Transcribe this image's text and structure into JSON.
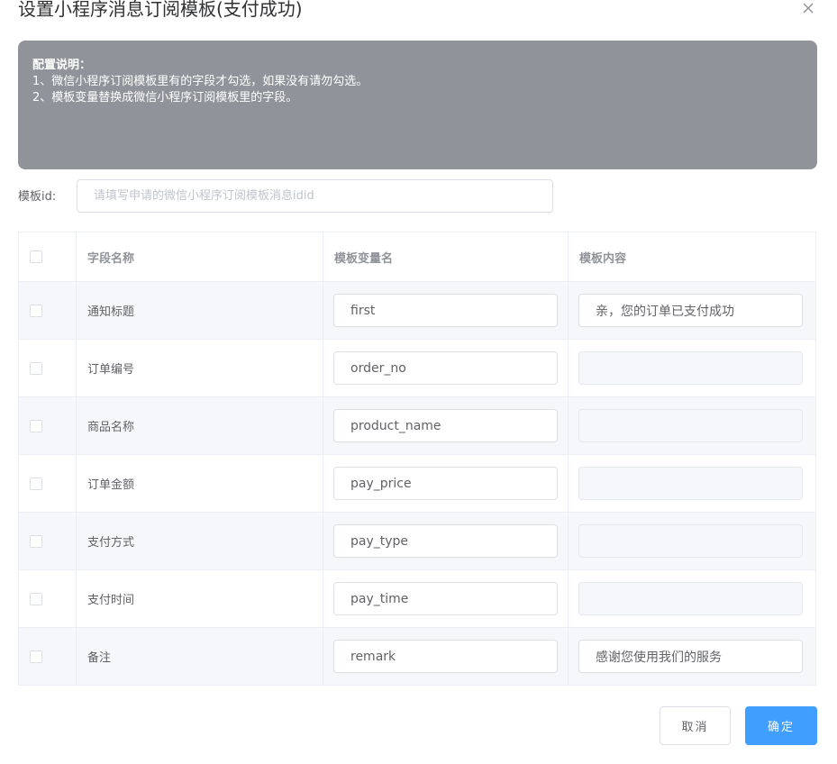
{
  "dialog": {
    "title": "设置小程序消息订阅模板(支付成功)",
    "close_icon": "close-icon"
  },
  "notice": {
    "heading": "配置说明：",
    "lines": [
      "1、微信小程序订阅模板里有的字段才勾选，如果没有请勿勾选。",
      "2、模板变量替换成微信小程序订阅模板里的字段。"
    ],
    "background": "#909399"
  },
  "template_id": {
    "label": "模板id:",
    "value": "",
    "placeholder": "请填写申请的微信小程序订阅模板消息idid"
  },
  "table": {
    "headers": [
      "字段名称",
      "模板变量名",
      "模板内容"
    ],
    "rows": [
      {
        "checked": false,
        "name": "通知标题",
        "var": "first",
        "content": "亲，您的订单已支付成功",
        "content_enabled": true
      },
      {
        "checked": false,
        "name": "订单编号",
        "var": "order_no",
        "content": "",
        "content_enabled": false
      },
      {
        "checked": false,
        "name": "商品名称",
        "var": "product_name",
        "content": "",
        "content_enabled": false
      },
      {
        "checked": false,
        "name": "订单金额",
        "var": "pay_price",
        "content": "",
        "content_enabled": false
      },
      {
        "checked": false,
        "name": "支付方式",
        "var": "pay_type",
        "content": "",
        "content_enabled": false
      },
      {
        "checked": false,
        "name": "支付时间",
        "var": "pay_time",
        "content": "",
        "content_enabled": false
      },
      {
        "checked": false,
        "name": "备注",
        "var": "remark",
        "content": "感谢您使用我们的服务",
        "content_enabled": true
      }
    ]
  },
  "footer": {
    "cancel_label": "取消",
    "confirm_label": "确定",
    "accent": "#409eff"
  }
}
